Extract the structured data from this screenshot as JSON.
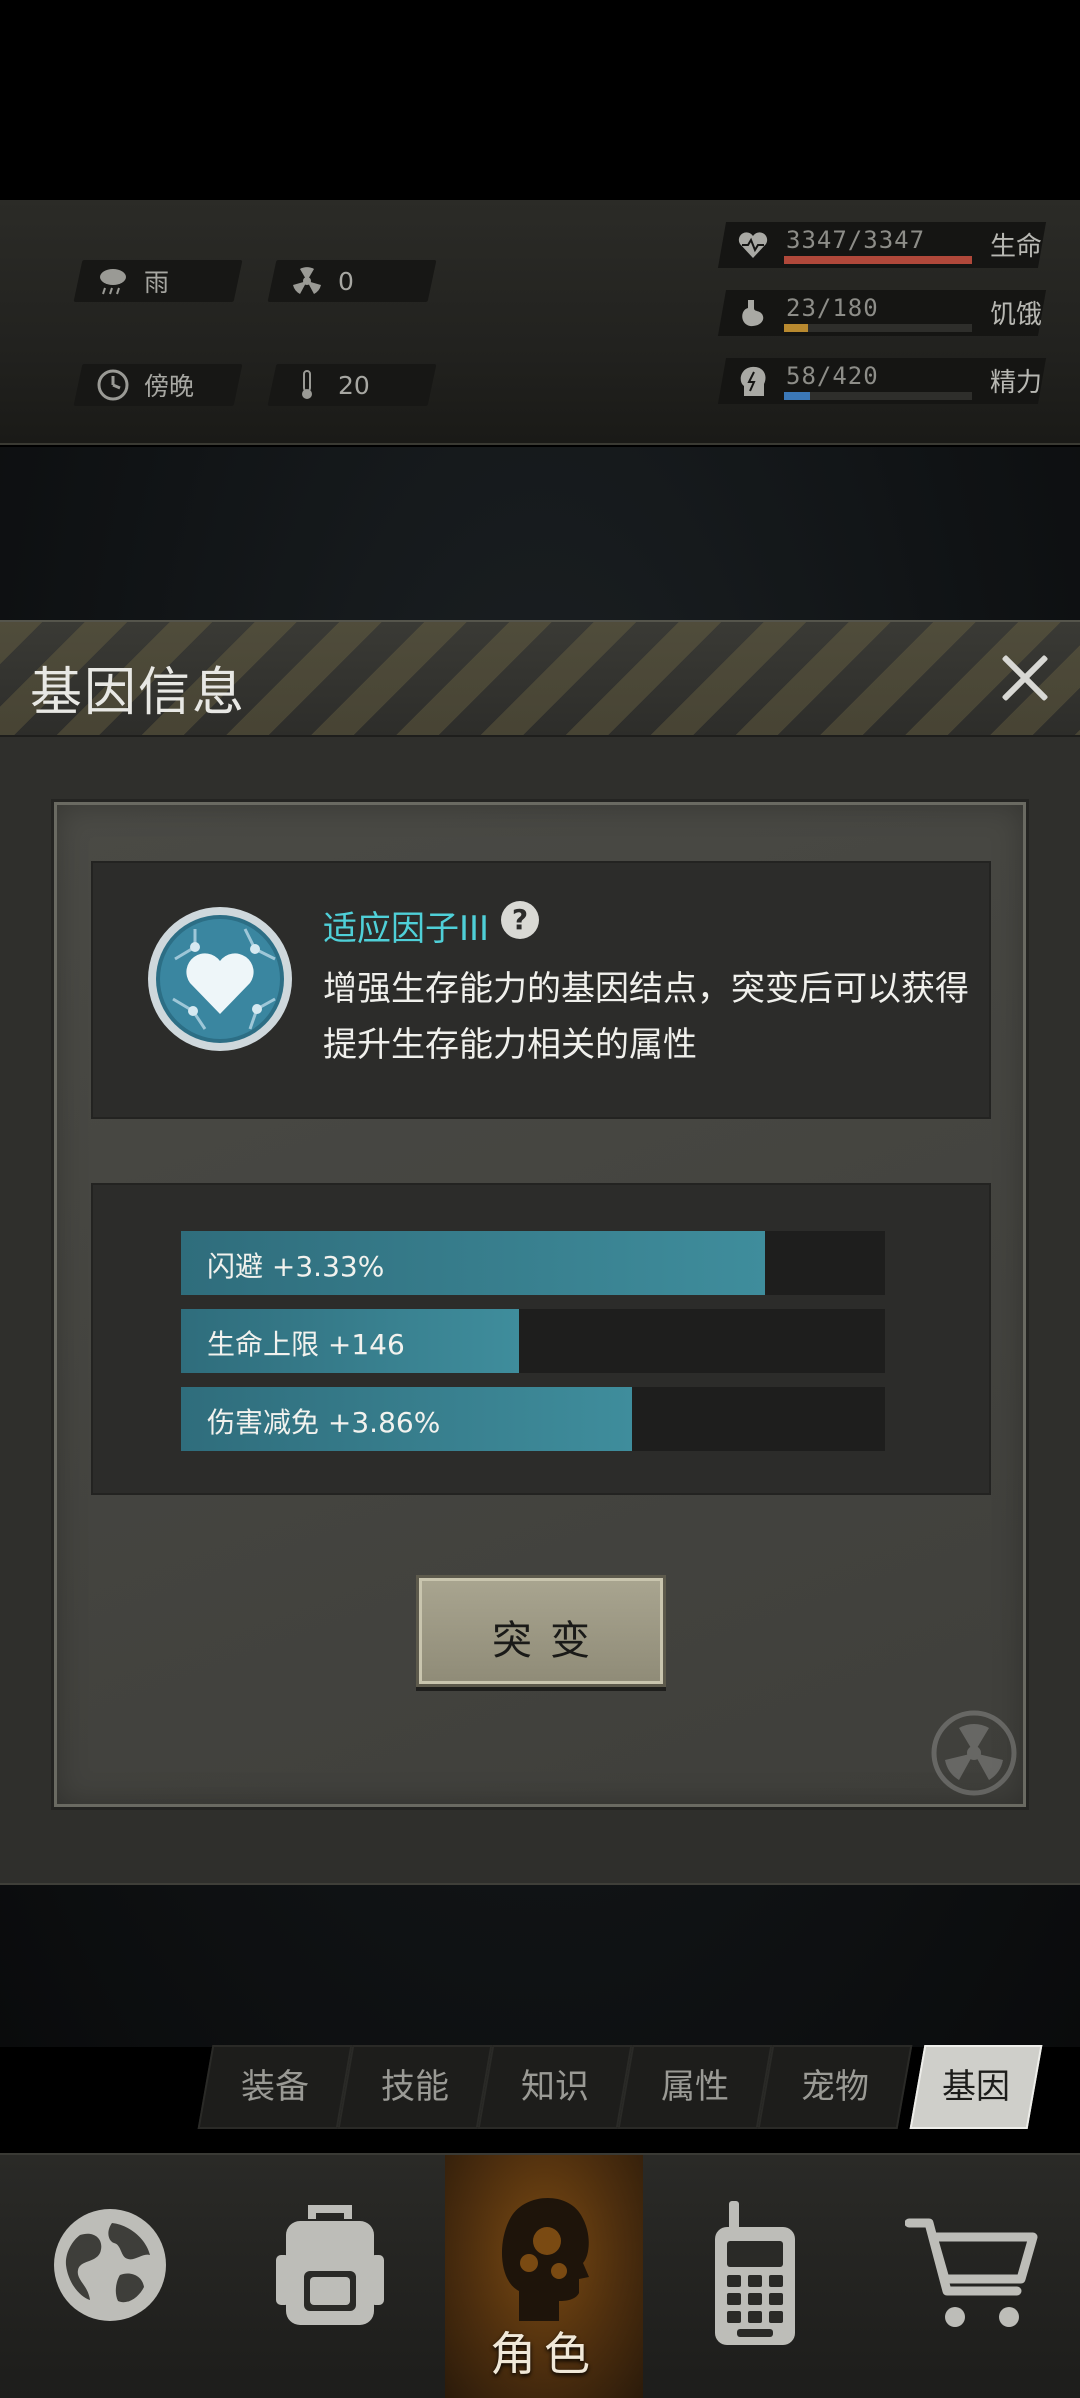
{
  "status": {
    "weather": "雨",
    "radiation": "0",
    "time_of_day": "傍晚",
    "temperature": "20",
    "stats": [
      {
        "icon": "heart-icon",
        "value": "3347/3347",
        "label": "生命",
        "fill_percent": 100,
        "color": "#b0483a"
      },
      {
        "icon": "stomach-icon",
        "value": "23/180",
        "label": "饥饿",
        "fill_percent": 13,
        "color": "#b8892f"
      },
      {
        "icon": "brain-icon",
        "value": "58/420",
        "label": "精力",
        "fill_percent": 14,
        "color": "#3b78b8"
      }
    ]
  },
  "modal": {
    "title": "基因信息",
    "gene_name": "适应因子III",
    "description": "增强生存能力的基因结点，突变后可以获得提升生存能力相关的属性",
    "attributes": [
      {
        "label": "闪避 +3.33%",
        "fill_percent": 83
      },
      {
        "label": "生命上限 +146",
        "fill_percent": 48
      },
      {
        "label": "伤害减免 +3.86%",
        "fill_percent": 64
      }
    ],
    "mutate_button": "突变"
  },
  "tabs": [
    "装备",
    "技能",
    "知识",
    "属性",
    "宠物",
    "基因"
  ],
  "active_tab": "基因",
  "bottom_nav": {
    "active_label": "角色"
  },
  "colors": {
    "accent_cyan": "#4fd0d8",
    "attr_bar": "#3f8d9c"
  }
}
